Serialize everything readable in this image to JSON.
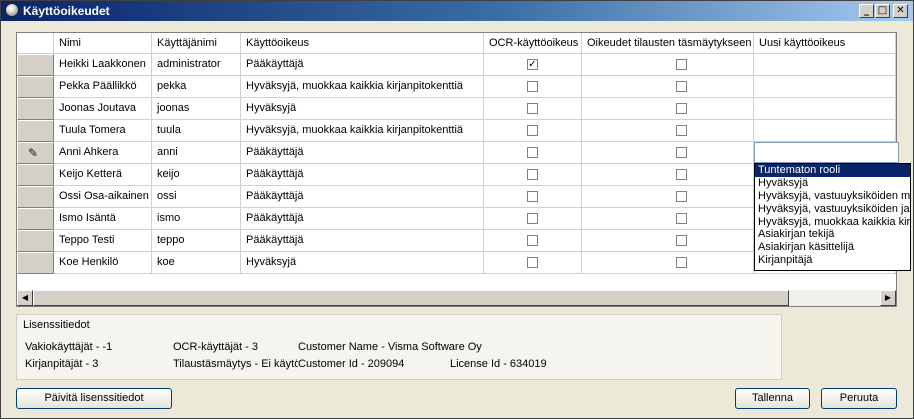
{
  "window": {
    "title": "Käyttöoikeudet"
  },
  "titlebar_buttons": {
    "minimize": "_",
    "maximize": "□",
    "close": "✕"
  },
  "grid": {
    "columns": [
      "Nimi",
      "Käyttäjänimi",
      "Käyttöoikeus",
      "OCR-käyttöoikeus",
      "Oikeudet tilausten täsmäytykseen",
      "Uusi käyttöoikeus"
    ],
    "rows": [
      {
        "name": "Heikki Laakkonen",
        "username": "administrator",
        "role": "Pääkäyttäjä",
        "ocr": true,
        "match": false,
        "new_role": ""
      },
      {
        "name": "Pekka Päällikkö",
        "username": "pekka",
        "role": "Hyväksyjä, muokkaa kaikkia kirjanpitokenttiä",
        "ocr": false,
        "match": false,
        "new_role": ""
      },
      {
        "name": "Joonas Joutava",
        "username": "joonas",
        "role": "Hyväksyjä",
        "ocr": false,
        "match": false,
        "new_role": ""
      },
      {
        "name": "Tuula Tomera",
        "username": "tuula",
        "role": "Hyväksyjä, muokkaa kaikkia kirjanpitokenttiä",
        "ocr": false,
        "match": false,
        "new_role": ""
      },
      {
        "name": "Anni Ahkera",
        "username": "anni",
        "role": "Pääkäyttäjä",
        "ocr": false,
        "match": false,
        "new_role": "",
        "editing": true
      },
      {
        "name": "Keijo Ketterä",
        "username": "keijo",
        "role": "Pääkäyttäjä",
        "ocr": false,
        "match": false,
        "new_role": ""
      },
      {
        "name": "Ossi Osa-aikainen",
        "username": "ossi",
        "role": "Pääkäyttäjä",
        "ocr": false,
        "match": false,
        "new_role": ""
      },
      {
        "name": "Ismo Isäntä",
        "username": "ismo",
        "role": "Pääkäyttäjä",
        "ocr": false,
        "match": false,
        "new_role": ""
      },
      {
        "name": "Teppo Testi",
        "username": "teppo",
        "role": "Pääkäyttäjä",
        "ocr": false,
        "match": false,
        "new_role": ""
      },
      {
        "name": "Koe Henkilö",
        "username": "koe",
        "role": "Hyväksyjä",
        "ocr": false,
        "match": false,
        "new_role": ""
      }
    ],
    "check_mark": "✓",
    "edit_icon": "pencil-icon",
    "scroll": {
      "left_arrow": "◀",
      "right_arrow": "▶"
    }
  },
  "role_dropdown": {
    "selected_index": 0,
    "options": [
      "Tuntematon rooli",
      "Hyväksyjä",
      "Hyväksyjä, vastuuyksiköiden mu",
      "Hyväksyjä, vastuuyksiköiden ja",
      "Hyväksyjä, muokkaa kaikkia kirj",
      "Asiakirjan tekijä",
      "Asiakirjan käsittelijä",
      "Kirjanpitäjä"
    ]
  },
  "license": {
    "title": "Lisenssitiedot",
    "standard_users": "Vakiokäyttäjät - -1",
    "accountants": "Kirjanpitäjät - 3",
    "ocr_users": "OCR-käyttäjät - 3",
    "order_matching": "Tilaustäsmäytys - Ei käytö",
    "customer_name": "Customer Name - Visma Software Oy",
    "customer_id": "Customer Id - 209094",
    "license_id": "License Id - 634019"
  },
  "buttons": {
    "refresh": "Päivitä lisenssitiedot",
    "save": "Tallenna",
    "cancel": "Peruuta"
  },
  "colors": {
    "selection": "#0a246a",
    "title_gradient_start": "#0a246a"
  }
}
